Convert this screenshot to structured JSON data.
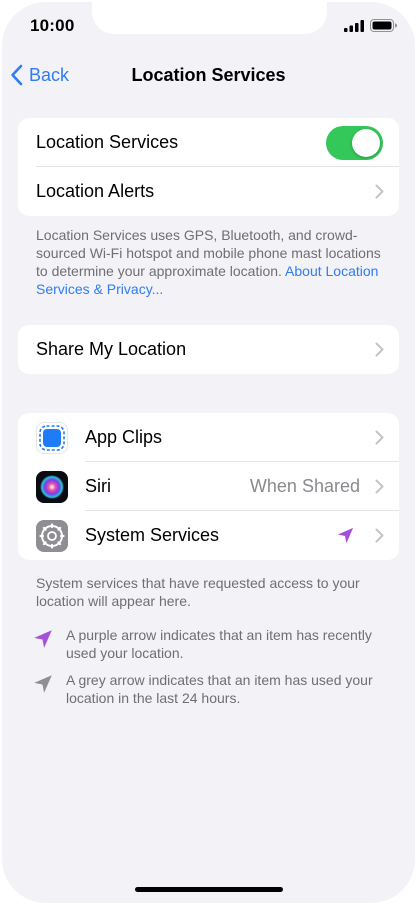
{
  "status_bar": {
    "time": "10:00"
  },
  "nav": {
    "back_label": "Back",
    "title": "Location Services"
  },
  "group_main": {
    "location_services_label": "Location Services",
    "location_services_enabled": true,
    "location_alerts_label": "Location Alerts"
  },
  "footnote_main": {
    "text": "Location Services uses GPS, Bluetooth, and crowd-sourced Wi-Fi hotspot and mobile phone mast locations to determine your approximate location. ",
    "link": "About Location Services & Privacy..."
  },
  "group_share": {
    "share_label": "Share My Location"
  },
  "group_apps": {
    "items": [
      {
        "label": "App Clips",
        "value": "",
        "icon": "app-clips-icon"
      },
      {
        "label": "Siri",
        "value": "When Shared",
        "icon": "siri-icon"
      },
      {
        "label": "System Services",
        "value": "",
        "icon": "gear-icon",
        "recently_used": true
      }
    ]
  },
  "footnote_system": {
    "text": "System services that have requested access to your location will appear here."
  },
  "legend": {
    "purple": "A purple arrow indicates that an item has recently used your location.",
    "grey": "A grey arrow indicates that an item has used your location in the last 24 hours."
  },
  "colors": {
    "accent": "#2f7cf6",
    "toggle_on": "#34c759",
    "purple_arrow": "#a550d8",
    "grey_arrow": "#8e8e93",
    "background": "#f2f2f7"
  }
}
